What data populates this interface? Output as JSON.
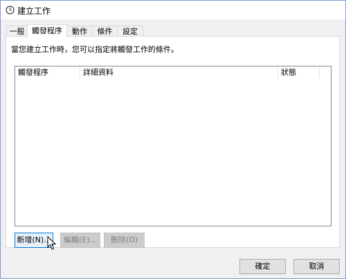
{
  "window": {
    "title": "建立工作"
  },
  "tabs": [
    {
      "label": "一般"
    },
    {
      "label": "觸發程序"
    },
    {
      "label": "動作"
    },
    {
      "label": "條件"
    },
    {
      "label": "設定"
    }
  ],
  "active_tab": "觸發程序",
  "description": "當您建立工作時，您可以指定將觸發工作的條件。",
  "list": {
    "columns": [
      {
        "label": "觸發程序"
      },
      {
        "label": "詳細資料"
      },
      {
        "label": "狀態"
      }
    ],
    "rows": []
  },
  "buttons": {
    "new": "新增(N)...",
    "edit": "編輯(E)...",
    "delete": "刪除(D)",
    "ok": "確定",
    "cancel": "取消"
  },
  "icons": {
    "title": "clock-icon",
    "cursor": "mouse-pointer-icon"
  },
  "colors": {
    "focus_border": "#0078d7",
    "window_border": "#7a9cd3"
  }
}
